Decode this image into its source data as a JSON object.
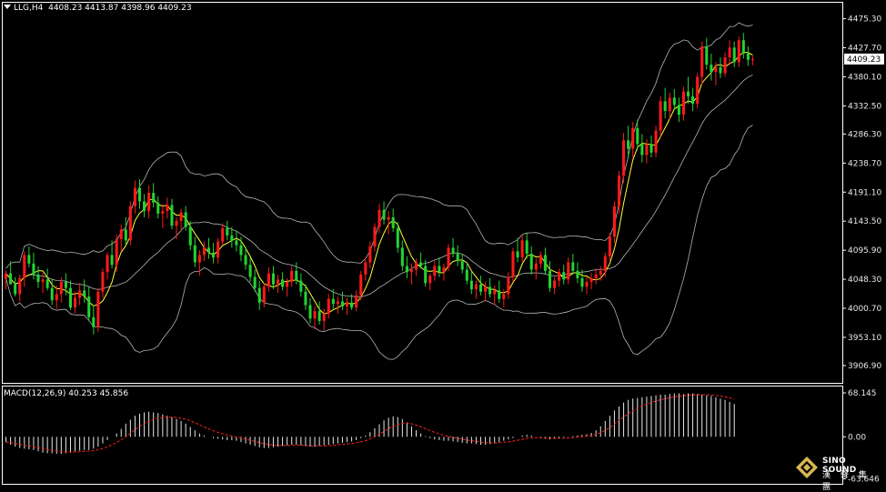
{
  "header": {
    "symbol": "LLG,H4",
    "ohlc": "4408.23 4413.87 4398.96 4409.23"
  },
  "macd_header": {
    "label": "MACD(12,26,9) 40.253 45.856"
  },
  "logo": {
    "name": "SINO SOUND",
    "chinese": "漢 聲 集 團"
  },
  "colors": {
    "background": "#000000",
    "bull": "#ff1a1a",
    "bear": "#22d433",
    "frame": "#ffffff",
    "bands": "#b4b4b4",
    "ma": "#ffff33",
    "macd_hist": "#e6e6e6",
    "macd_signal": "#ff2020",
    "price_tag_bg": "#ffffff",
    "price_tag_text": "#000000"
  },
  "chart_data": {
    "type": "candlestick",
    "price_axis": {
      "ylim": [
        3880,
        4500
      ],
      "ticks": [
        "4475.30",
        "4427.70",
        "4380.10",
        "4332.50",
        "4286.30",
        "4238.70",
        "4191.10",
        "4143.50",
        "4095.90",
        "4048.30",
        "4000.70",
        "3953.10",
        "3906.90"
      ],
      "current_price": "4409.23"
    },
    "macd_axis": {
      "ylim": [
        -70,
        75
      ],
      "ticks": [
        "68.145",
        "0.00",
        "-63.646"
      ]
    },
    "candles": [
      [
        4049,
        4063,
        4032,
        4058
      ],
      [
        4058,
        4078,
        4044,
        4040
      ],
      [
        4040,
        4052,
        4020,
        4024
      ],
      [
        4024,
        4056,
        4012,
        4050
      ],
      [
        4050,
        4094,
        4036,
        4088
      ],
      [
        4088,
        4102,
        4068,
        4074
      ],
      [
        4074,
        4092,
        4048,
        4056
      ],
      [
        4056,
        4070,
        4034,
        4044
      ],
      [
        4044,
        4058,
        4026,
        4048
      ],
      [
        4048,
        4066,
        4030,
        4034
      ],
      [
        4034,
        4048,
        4006,
        4014
      ],
      [
        4014,
        4038,
        4000,
        4024
      ],
      [
        4024,
        4052,
        4010,
        4044
      ],
      [
        4044,
        4058,
        4022,
        4034
      ],
      [
        4034,
        4046,
        3998,
        4002
      ],
      [
        4002,
        4028,
        3992,
        4018
      ],
      [
        4018,
        4042,
        4006,
        4030
      ],
      [
        4030,
        4048,
        4010,
        4020
      ],
      [
        4020,
        4036,
        3980,
        3986
      ],
      [
        3986,
        4006,
        3958,
        3970
      ],
      [
        3970,
        4034,
        3962,
        4028
      ],
      [
        4028,
        4066,
        4018,
        4060
      ],
      [
        4060,
        4092,
        4048,
        4088
      ],
      [
        4088,
        4112,
        4066,
        4072
      ],
      [
        4072,
        4122,
        4060,
        4114
      ],
      [
        4114,
        4138,
        4094,
        4130
      ],
      [
        4130,
        4150,
        4104,
        4112
      ],
      [
        4112,
        4176,
        4104,
        4168
      ],
      [
        4168,
        4210,
        4156,
        4198
      ],
      [
        4198,
        4212,
        4164,
        4176
      ],
      [
        4176,
        4188,
        4150,
        4160
      ],
      [
        4160,
        4202,
        4148,
        4190
      ],
      [
        4190,
        4206,
        4166,
        4174
      ],
      [
        4174,
        4184,
        4148,
        4156
      ],
      [
        4156,
        4172,
        4132,
        4160
      ],
      [
        4160,
        4182,
        4148,
        4170
      ],
      [
        4170,
        4180,
        4130,
        4136
      ],
      [
        4136,
        4150,
        4114,
        4144
      ],
      [
        4144,
        4164,
        4130,
        4158
      ],
      [
        4158,
        4168,
        4128,
        4134
      ],
      [
        4134,
        4144,
        4096,
        4104
      ],
      [
        4104,
        4118,
        4068,
        4076
      ],
      [
        4076,
        4096,
        4054,
        4088
      ],
      [
        4088,
        4110,
        4078,
        4100
      ],
      [
        4100,
        4116,
        4082,
        4092
      ],
      [
        4092,
        4108,
        4074,
        4084
      ],
      [
        4084,
        4116,
        4074,
        4110
      ],
      [
        4110,
        4140,
        4104,
        4132
      ],
      [
        4132,
        4144,
        4112,
        4120
      ],
      [
        4120,
        4134,
        4100,
        4112
      ],
      [
        4112,
        4128,
        4094,
        4104
      ],
      [
        4104,
        4118,
        4078,
        4088
      ],
      [
        4088,
        4102,
        4064,
        4072
      ],
      [
        4072,
        4084,
        4044,
        4052
      ],
      [
        4052,
        4064,
        4028,
        4034
      ],
      [
        4034,
        4046,
        3998,
        4010
      ],
      [
        4010,
        4042,
        4002,
        4036
      ],
      [
        4036,
        4068,
        4028,
        4058
      ],
      [
        4058,
        4070,
        4032,
        4040
      ],
      [
        4040,
        4056,
        4026,
        4048
      ],
      [
        4048,
        4060,
        4030,
        4036
      ],
      [
        4036,
        4050,
        4020,
        4044
      ],
      [
        4044,
        4070,
        4036,
        4062
      ],
      [
        4062,
        4076,
        4040,
        4046
      ],
      [
        4046,
        4058,
        4020,
        4028
      ],
      [
        4028,
        4040,
        3998,
        4006
      ],
      [
        4006,
        4018,
        3976,
        3984
      ],
      [
        3984,
        4004,
        3966,
        3996
      ],
      [
        3996,
        4012,
        3974,
        3980
      ],
      [
        3980,
        4000,
        3964,
        3992
      ],
      [
        3992,
        4024,
        3984,
        4016
      ],
      [
        4016,
        4032,
        4000,
        4008
      ],
      [
        4008,
        4020,
        3992,
        4012
      ],
      [
        4012,
        4028,
        3998,
        4004
      ],
      [
        4004,
        4018,
        3990,
        4010
      ],
      [
        4010,
        4024,
        3998,
        4002
      ],
      [
        4002,
        4030,
        3996,
        4022
      ],
      [
        4022,
        4062,
        4014,
        4056
      ],
      [
        4056,
        4084,
        4046,
        4076
      ],
      [
        4076,
        4110,
        4066,
        4102
      ],
      [
        4102,
        4140,
        4094,
        4134
      ],
      [
        4134,
        4172,
        4124,
        4162
      ],
      [
        4162,
        4176,
        4138,
        4146
      ],
      [
        4146,
        4160,
        4122,
        4150
      ],
      [
        4150,
        4164,
        4126,
        4132
      ],
      [
        4132,
        4142,
        4092,
        4100
      ],
      [
        4100,
        4112,
        4062,
        4070
      ],
      [
        4070,
        4086,
        4050,
        4060
      ],
      [
        4060,
        4074,
        4040,
        4064
      ],
      [
        4064,
        4082,
        4054,
        4076
      ],
      [
        4076,
        4092,
        4066,
        4070
      ],
      [
        4070,
        4080,
        4036,
        4042
      ],
      [
        4042,
        4058,
        4030,
        4054
      ],
      [
        4054,
        4078,
        4046,
        4070
      ],
      [
        4070,
        4084,
        4052,
        4060
      ],
      [
        4060,
        4074,
        4046,
        4068
      ],
      [
        4068,
        4106,
        4062,
        4100
      ],
      [
        4100,
        4116,
        4084,
        4090
      ],
      [
        4090,
        4104,
        4070,
        4078
      ],
      [
        4078,
        4090,
        4058,
        4064
      ],
      [
        4064,
        4076,
        4040,
        4046
      ],
      [
        4046,
        4060,
        4024,
        4032
      ],
      [
        4032,
        4046,
        4016,
        4040
      ],
      [
        4040,
        4054,
        4022,
        4028
      ],
      [
        4028,
        4044,
        4012,
        4036
      ],
      [
        4036,
        4050,
        4018,
        4024
      ],
      [
        4024,
        4038,
        4006,
        4030
      ],
      [
        4030,
        4046,
        4010,
        4016
      ],
      [
        4016,
        4032,
        4002,
        4024
      ],
      [
        4024,
        4060,
        4016,
        4052
      ],
      [
        4052,
        4100,
        4044,
        4094
      ],
      [
        4094,
        4116,
        4076,
        4084
      ],
      [
        4084,
        4122,
        4076,
        4112
      ],
      [
        4112,
        4124,
        4082,
        4090
      ],
      [
        4090,
        4102,
        4056,
        4064
      ],
      [
        4064,
        4082,
        4048,
        4074
      ],
      [
        4074,
        4094,
        4066,
        4088
      ],
      [
        4088,
        4100,
        4056,
        4062
      ],
      [
        4062,
        4078,
        4028,
        4034
      ],
      [
        4034,
        4052,
        4024,
        4046
      ],
      [
        4046,
        4066,
        4036,
        4060
      ],
      [
        4060,
        4072,
        4040,
        4048
      ],
      [
        4048,
        4084,
        4040,
        4076
      ],
      [
        4076,
        4090,
        4056,
        4062
      ],
      [
        4062,
        4076,
        4042,
        4050
      ],
      [
        4050,
        4064,
        4028,
        4036
      ],
      [
        4036,
        4052,
        4024,
        4044
      ],
      [
        4044,
        4058,
        4032,
        4050
      ],
      [
        4050,
        4066,
        4040,
        4056
      ],
      [
        4056,
        4070,
        4046,
        4062
      ],
      [
        4062,
        4092,
        4052,
        4086
      ],
      [
        4086,
        4124,
        4078,
        4118
      ],
      [
        4118,
        4176,
        4108,
        4168
      ],
      [
        4168,
        4226,
        4156,
        4218
      ],
      [
        4218,
        4288,
        4206,
        4276
      ],
      [
        4276,
        4300,
        4246,
        4262
      ],
      [
        4262,
        4306,
        4248,
        4296
      ],
      [
        4296,
        4310,
        4260,
        4270
      ],
      [
        4270,
        4286,
        4240,
        4252
      ],
      [
        4252,
        4278,
        4238,
        4270
      ],
      [
        4270,
        4284,
        4248,
        4256
      ],
      [
        4256,
        4300,
        4248,
        4292
      ],
      [
        4292,
        4348,
        4282,
        4340
      ],
      [
        4340,
        4362,
        4312,
        4324
      ],
      [
        4324,
        4354,
        4310,
        4346
      ],
      [
        4346,
        4360,
        4326,
        4334
      ],
      [
        4334,
        4346,
        4306,
        4318
      ],
      [
        4318,
        4364,
        4308,
        4356
      ],
      [
        4356,
        4380,
        4336,
        4348
      ],
      [
        4348,
        4362,
        4324,
        4336
      ],
      [
        4336,
        4386,
        4328,
        4380
      ],
      [
        4380,
        4438,
        4368,
        4430
      ],
      [
        4430,
        4444,
        4392,
        4400
      ],
      [
        4400,
        4418,
        4374,
        4388
      ],
      [
        4388,
        4404,
        4366,
        4396
      ],
      [
        4396,
        4412,
        4378,
        4386
      ],
      [
        4386,
        4420,
        4380,
        4412
      ],
      [
        4412,
        4440,
        4400,
        4428
      ],
      [
        4428,
        4438,
        4396,
        4404
      ],
      [
        4404,
        4446,
        4396,
        4440
      ],
      [
        4440,
        4452,
        4410,
        4418
      ],
      [
        4418,
        4430,
        4398,
        4408
      ],
      [
        4408,
        4414,
        4399,
        4409
      ]
    ],
    "macd_hist": [
      -8,
      -12,
      -15,
      -17,
      -18,
      -19,
      -20,
      -22,
      -24,
      -25,
      -25,
      -26,
      -26,
      -25,
      -24,
      -22,
      -21,
      -20,
      -20,
      -18,
      -15,
      -10,
      -5,
      0,
      5,
      12,
      20,
      26,
      32,
      35,
      37,
      38,
      37,
      36,
      34,
      32,
      30,
      27,
      24,
      20,
      15,
      10,
      5,
      2,
      0,
      -2,
      -3,
      -4,
      -5,
      -5,
      -6,
      -8,
      -10,
      -12,
      -14,
      -16,
      -17,
      -17,
      -16,
      -15,
      -14,
      -13,
      -12,
      -12,
      -13,
      -14,
      -15,
      -15,
      -14,
      -13,
      -12,
      -11,
      -10,
      -9,
      -8,
      -7,
      -5,
      -2,
      2,
      7,
      13,
      19,
      25,
      29,
      31,
      30,
      27,
      22,
      16,
      10,
      5,
      1,
      -2,
      -4,
      -5,
      -6,
      -6,
      -7,
      -8,
      -9,
      -10,
      -10,
      -11,
      -12,
      -12,
      -11,
      -10,
      -8,
      -6,
      -4,
      -2,
      0,
      2,
      3,
      2,
      0,
      -2,
      -3,
      -4,
      -3,
      -2,
      -1,
      0,
      1,
      2,
      3,
      4,
      6,
      10,
      16,
      24,
      32,
      40,
      46,
      52,
      56,
      58,
      59,
      60,
      61,
      62,
      63,
      64,
      64,
      65,
      66,
      66,
      65,
      66,
      66,
      65,
      64,
      63,
      62,
      60,
      58,
      56,
      53,
      50
    ]
  }
}
